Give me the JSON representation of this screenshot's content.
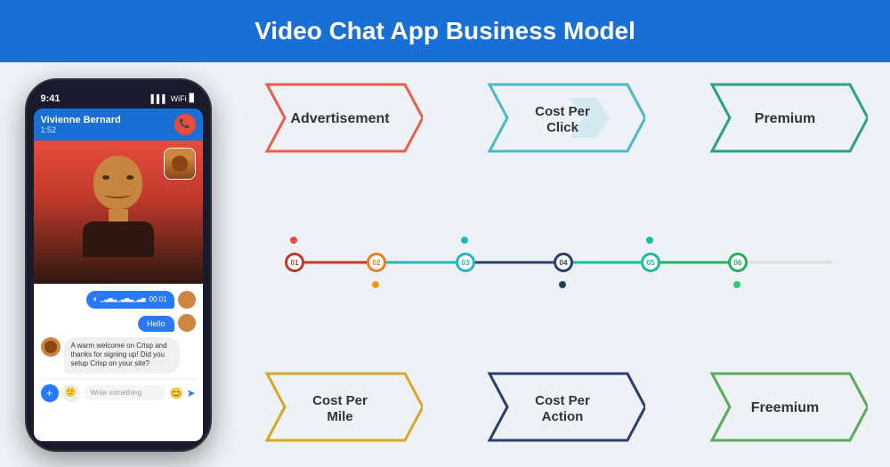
{
  "header": {
    "title": "Video Chat App Business Model"
  },
  "phone": {
    "time": "9:41",
    "signal": "▌▌▌",
    "wifi": "WiFi",
    "battery": "🔋",
    "caller_name": "Vivienne Bernard",
    "call_time": "1:52",
    "chat_messages": [
      {
        "type": "right-audio",
        "text": "00:01"
      },
      {
        "type": "right",
        "text": "Hello"
      },
      {
        "type": "left",
        "text": "A warm welcome on Crisp and thanks for signing up! Did you setup Crisp on your site?"
      }
    ],
    "input_placeholder": "Write something"
  },
  "business_model": {
    "top_shapes": [
      {
        "label": "Advertisement",
        "color": "#e8604c"
      },
      {
        "label": "Cost Per Click",
        "color": "#4db8c8"
      },
      {
        "label": "Premium",
        "color": "#2d9e8e"
      }
    ],
    "bottom_shapes": [
      {
        "label": "Cost Per Mile",
        "color": "#d4a82a"
      },
      {
        "label": "Cost Per Action",
        "color": "#2c3e6b"
      },
      {
        "label": "Freemium",
        "color": "#5aaa5a"
      }
    ],
    "nodes": [
      {
        "label": "01",
        "color": "#c0392b"
      },
      {
        "label": "02",
        "color": "#e67e22"
      },
      {
        "label": "03",
        "color": "#27b6bc"
      },
      {
        "label": "04",
        "color": "#2c3e6b"
      },
      {
        "label": "05",
        "color": "#1abc9c"
      },
      {
        "label": "06",
        "color": "#27ae60"
      }
    ]
  }
}
